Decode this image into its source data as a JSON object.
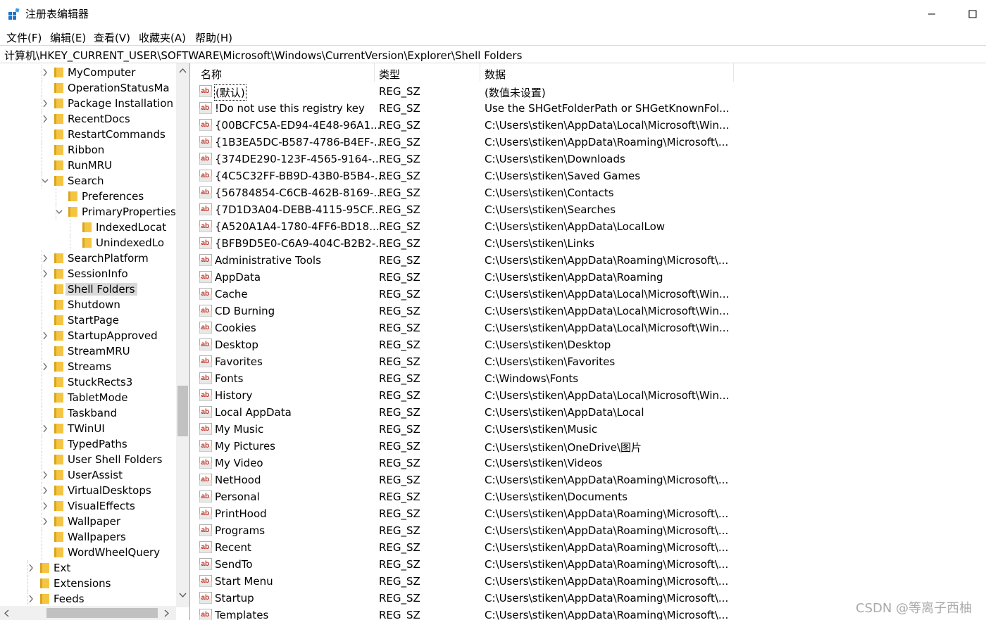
{
  "window": {
    "title": "注册表编辑器",
    "accent_color": "#1e73c8"
  },
  "menu": [
    "文件(F)",
    "编辑(E)",
    "查看(V)",
    "收藏夹(A)",
    "帮助(H)"
  ],
  "address": "计算机\\HKEY_CURRENT_USER\\SOFTWARE\\Microsoft\\Windows\\CurrentVersion\\Explorer\\Shell Folders",
  "tree": [
    {
      "label": "MyComputer",
      "level": 2,
      "chevron": "right"
    },
    {
      "label": "OperationStatusMa",
      "level": 2,
      "chevron": ""
    },
    {
      "label": "Package Installation",
      "level": 2,
      "chevron": "right"
    },
    {
      "label": "RecentDocs",
      "level": 2,
      "chevron": "right"
    },
    {
      "label": "RestartCommands",
      "level": 2,
      "chevron": ""
    },
    {
      "label": "Ribbon",
      "level": 2,
      "chevron": ""
    },
    {
      "label": "RunMRU",
      "level": 2,
      "chevron": ""
    },
    {
      "label": "Search",
      "level": 2,
      "chevron": "down"
    },
    {
      "label": "Preferences",
      "level": 3,
      "chevron": ""
    },
    {
      "label": "PrimaryProperties",
      "level": 3,
      "chevron": "down"
    },
    {
      "label": "IndexedLocat",
      "level": 4,
      "chevron": ""
    },
    {
      "label": "UnindexedLo",
      "level": 4,
      "chevron": ""
    },
    {
      "label": "SearchPlatform",
      "level": 2,
      "chevron": "right"
    },
    {
      "label": "SessionInfo",
      "level": 2,
      "chevron": "right"
    },
    {
      "label": "Shell Folders",
      "level": 2,
      "chevron": "",
      "selected": true
    },
    {
      "label": "Shutdown",
      "level": 2,
      "chevron": ""
    },
    {
      "label": "StartPage",
      "level": 2,
      "chevron": ""
    },
    {
      "label": "StartupApproved",
      "level": 2,
      "chevron": "right"
    },
    {
      "label": "StreamMRU",
      "level": 2,
      "chevron": ""
    },
    {
      "label": "Streams",
      "level": 2,
      "chevron": "right"
    },
    {
      "label": "StuckRects3",
      "level": 2,
      "chevron": ""
    },
    {
      "label": "TabletMode",
      "level": 2,
      "chevron": ""
    },
    {
      "label": "Taskband",
      "level": 2,
      "chevron": ""
    },
    {
      "label": "TWinUI",
      "level": 2,
      "chevron": "right"
    },
    {
      "label": "TypedPaths",
      "level": 2,
      "chevron": ""
    },
    {
      "label": "User Shell Folders",
      "level": 2,
      "chevron": ""
    },
    {
      "label": "UserAssist",
      "level": 2,
      "chevron": "right"
    },
    {
      "label": "VirtualDesktops",
      "level": 2,
      "chevron": "right"
    },
    {
      "label": "VisualEffects",
      "level": 2,
      "chevron": "right"
    },
    {
      "label": "Wallpaper",
      "level": 2,
      "chevron": "right"
    },
    {
      "label": "Wallpapers",
      "level": 2,
      "chevron": ""
    },
    {
      "label": "WordWheelQuery",
      "level": 2,
      "chevron": ""
    },
    {
      "label": "Ext",
      "level": 1,
      "chevron": "right"
    },
    {
      "label": "Extensions",
      "level": 1,
      "chevron": ""
    },
    {
      "label": "Feeds",
      "level": 1,
      "chevron": "right"
    }
  ],
  "columns": {
    "name": "名称",
    "type": "类型",
    "data": "数据"
  },
  "rows": [
    {
      "name": "(默认)",
      "type": "REG_SZ",
      "data": "(数值未设置)",
      "focused": true
    },
    {
      "name": "!Do not use this registry key",
      "type": "REG_SZ",
      "data": "Use the SHGetFolderPath or SHGetKnownFol..."
    },
    {
      "name": "{00BCFC5A-ED94-4E48-96A1...",
      "type": "REG_SZ",
      "data": "C:\\Users\\stiken\\AppData\\Local\\Microsoft\\Win..."
    },
    {
      "name": "{1B3EA5DC-B587-4786-B4EF-...",
      "type": "REG_SZ",
      "data": "C:\\Users\\stiken\\AppData\\Roaming\\Microsoft\\..."
    },
    {
      "name": "{374DE290-123F-4565-9164-...",
      "type": "REG_SZ",
      "data": "C:\\Users\\stiken\\Downloads"
    },
    {
      "name": "{4C5C32FF-BB9D-43B0-B5B4-...",
      "type": "REG_SZ",
      "data": "C:\\Users\\stiken\\Saved Games"
    },
    {
      "name": "{56784854-C6CB-462B-8169-...",
      "type": "REG_SZ",
      "data": "C:\\Users\\stiken\\Contacts"
    },
    {
      "name": "{7D1D3A04-DEBB-4115-95CF...",
      "type": "REG_SZ",
      "data": "C:\\Users\\stiken\\Searches"
    },
    {
      "name": "{A520A1A4-1780-4FF6-BD18...",
      "type": "REG_SZ",
      "data": "C:\\Users\\stiken\\AppData\\LocalLow"
    },
    {
      "name": "{BFB9D5E0-C6A9-404C-B2B2-...",
      "type": "REG_SZ",
      "data": "C:\\Users\\stiken\\Links"
    },
    {
      "name": "Administrative Tools",
      "type": "REG_SZ",
      "data": "C:\\Users\\stiken\\AppData\\Roaming\\Microsoft\\..."
    },
    {
      "name": "AppData",
      "type": "REG_SZ",
      "data": "C:\\Users\\stiken\\AppData\\Roaming"
    },
    {
      "name": "Cache",
      "type": "REG_SZ",
      "data": "C:\\Users\\stiken\\AppData\\Local\\Microsoft\\Win..."
    },
    {
      "name": "CD Burning",
      "type": "REG_SZ",
      "data": "C:\\Users\\stiken\\AppData\\Local\\Microsoft\\Win..."
    },
    {
      "name": "Cookies",
      "type": "REG_SZ",
      "data": "C:\\Users\\stiken\\AppData\\Local\\Microsoft\\Win..."
    },
    {
      "name": "Desktop",
      "type": "REG_SZ",
      "data": "C:\\Users\\stiken\\Desktop"
    },
    {
      "name": "Favorites",
      "type": "REG_SZ",
      "data": "C:\\Users\\stiken\\Favorites"
    },
    {
      "name": "Fonts",
      "type": "REG_SZ",
      "data": "C:\\Windows\\Fonts"
    },
    {
      "name": "History",
      "type": "REG_SZ",
      "data": "C:\\Users\\stiken\\AppData\\Local\\Microsoft\\Win..."
    },
    {
      "name": "Local AppData",
      "type": "REG_SZ",
      "data": "C:\\Users\\stiken\\AppData\\Local"
    },
    {
      "name": "My Music",
      "type": "REG_SZ",
      "data": "C:\\Users\\stiken\\Music"
    },
    {
      "name": "My Pictures",
      "type": "REG_SZ",
      "data": "C:\\Users\\stiken\\OneDrive\\图片"
    },
    {
      "name": "My Video",
      "type": "REG_SZ",
      "data": "C:\\Users\\stiken\\Videos"
    },
    {
      "name": "NetHood",
      "type": "REG_SZ",
      "data": "C:\\Users\\stiken\\AppData\\Roaming\\Microsoft\\..."
    },
    {
      "name": "Personal",
      "type": "REG_SZ",
      "data": "C:\\Users\\stiken\\Documents"
    },
    {
      "name": "PrintHood",
      "type": "REG_SZ",
      "data": "C:\\Users\\stiken\\AppData\\Roaming\\Microsoft\\..."
    },
    {
      "name": "Programs",
      "type": "REG_SZ",
      "data": "C:\\Users\\stiken\\AppData\\Roaming\\Microsoft\\..."
    },
    {
      "name": "Recent",
      "type": "REG_SZ",
      "data": "C:\\Users\\stiken\\AppData\\Roaming\\Microsoft\\..."
    },
    {
      "name": "SendTo",
      "type": "REG_SZ",
      "data": "C:\\Users\\stiken\\AppData\\Roaming\\Microsoft\\..."
    },
    {
      "name": "Start Menu",
      "type": "REG_SZ",
      "data": "C:\\Users\\stiken\\AppData\\Roaming\\Microsoft\\..."
    },
    {
      "name": "Startup",
      "type": "REG_SZ",
      "data": "C:\\Users\\stiken\\AppData\\Roaming\\Microsoft\\..."
    },
    {
      "name": "Templates",
      "type": "REG_SZ",
      "data": "C:\\Users\\stiken\\AppData\\Roaming\\Microsoft\\..."
    }
  ],
  "watermark": "CSDN @等离子西柚",
  "colors": {
    "folder": "#f4c542",
    "folder_dark": "#d9a520",
    "ab_icon": "#c0392b",
    "selected_bg": "#d9d9d9"
  }
}
